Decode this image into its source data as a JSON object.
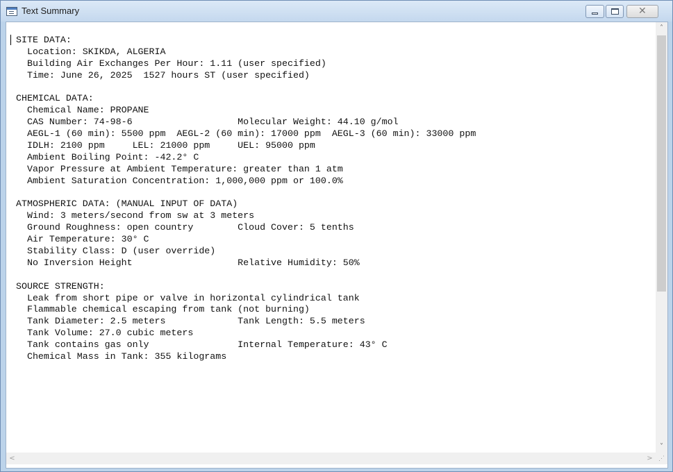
{
  "window": {
    "title": "Text Summary",
    "icons": {
      "app": "text-window-icon",
      "minimize": "minimize-icon",
      "maximize": "maximize-icon",
      "close": "close-icon"
    },
    "close_glyph": "✕"
  },
  "text_lines": [
    "SITE DATA:",
    "  Location: SKIKDA, ALGERIA",
    "  Building Air Exchanges Per Hour: 1.11 (user specified)",
    "  Time: June 26, 2025  1527 hours ST (user specified)",
    "",
    "CHEMICAL DATA:",
    "  Chemical Name: PROPANE",
    "  CAS Number: 74-98-6                   Molecular Weight: 44.10 g/mol",
    "  AEGL-1 (60 min): 5500 ppm  AEGL-2 (60 min): 17000 ppm  AEGL-3 (60 min): 33000 ppm",
    "  IDLH: 2100 ppm     LEL: 21000 ppm     UEL: 95000 ppm",
    "  Ambient Boiling Point: -42.2° C",
    "  Vapor Pressure at Ambient Temperature: greater than 1 atm",
    "  Ambient Saturation Concentration: 1,000,000 ppm or 100.0%",
    "",
    "ATMOSPHERIC DATA: (MANUAL INPUT OF DATA)",
    "  Wind: 3 meters/second from sw at 3 meters",
    "  Ground Roughness: open country        Cloud Cover: 5 tenths",
    "  Air Temperature: 30° C",
    "  Stability Class: D (user override)",
    "  No Inversion Height                   Relative Humidity: 50%",
    "",
    "SOURCE STRENGTH:",
    "  Leak from short pipe or valve in horizontal cylindrical tank",
    "  Flammable chemical escaping from tank (not burning)",
    "  Tank Diameter: 2.5 meters             Tank Length: 5.5 meters",
    "  Tank Volume: 27.0 cubic meters",
    "  Tank contains gas only                Internal Temperature: 43° C",
    "  Chemical Mass in Tank: 355 kilograms"
  ],
  "scrollbar": {
    "up_glyph": "˄",
    "down_glyph": "˅",
    "left_glyph": "<",
    "right_glyph": ">",
    "icons": {
      "up": "scroll-up-icon",
      "down": "scroll-down-icon",
      "left": "scroll-left-icon",
      "right": "scroll-right-icon",
      "grip": "size-grip-icon"
    },
    "vertical_position": 0.0
  }
}
